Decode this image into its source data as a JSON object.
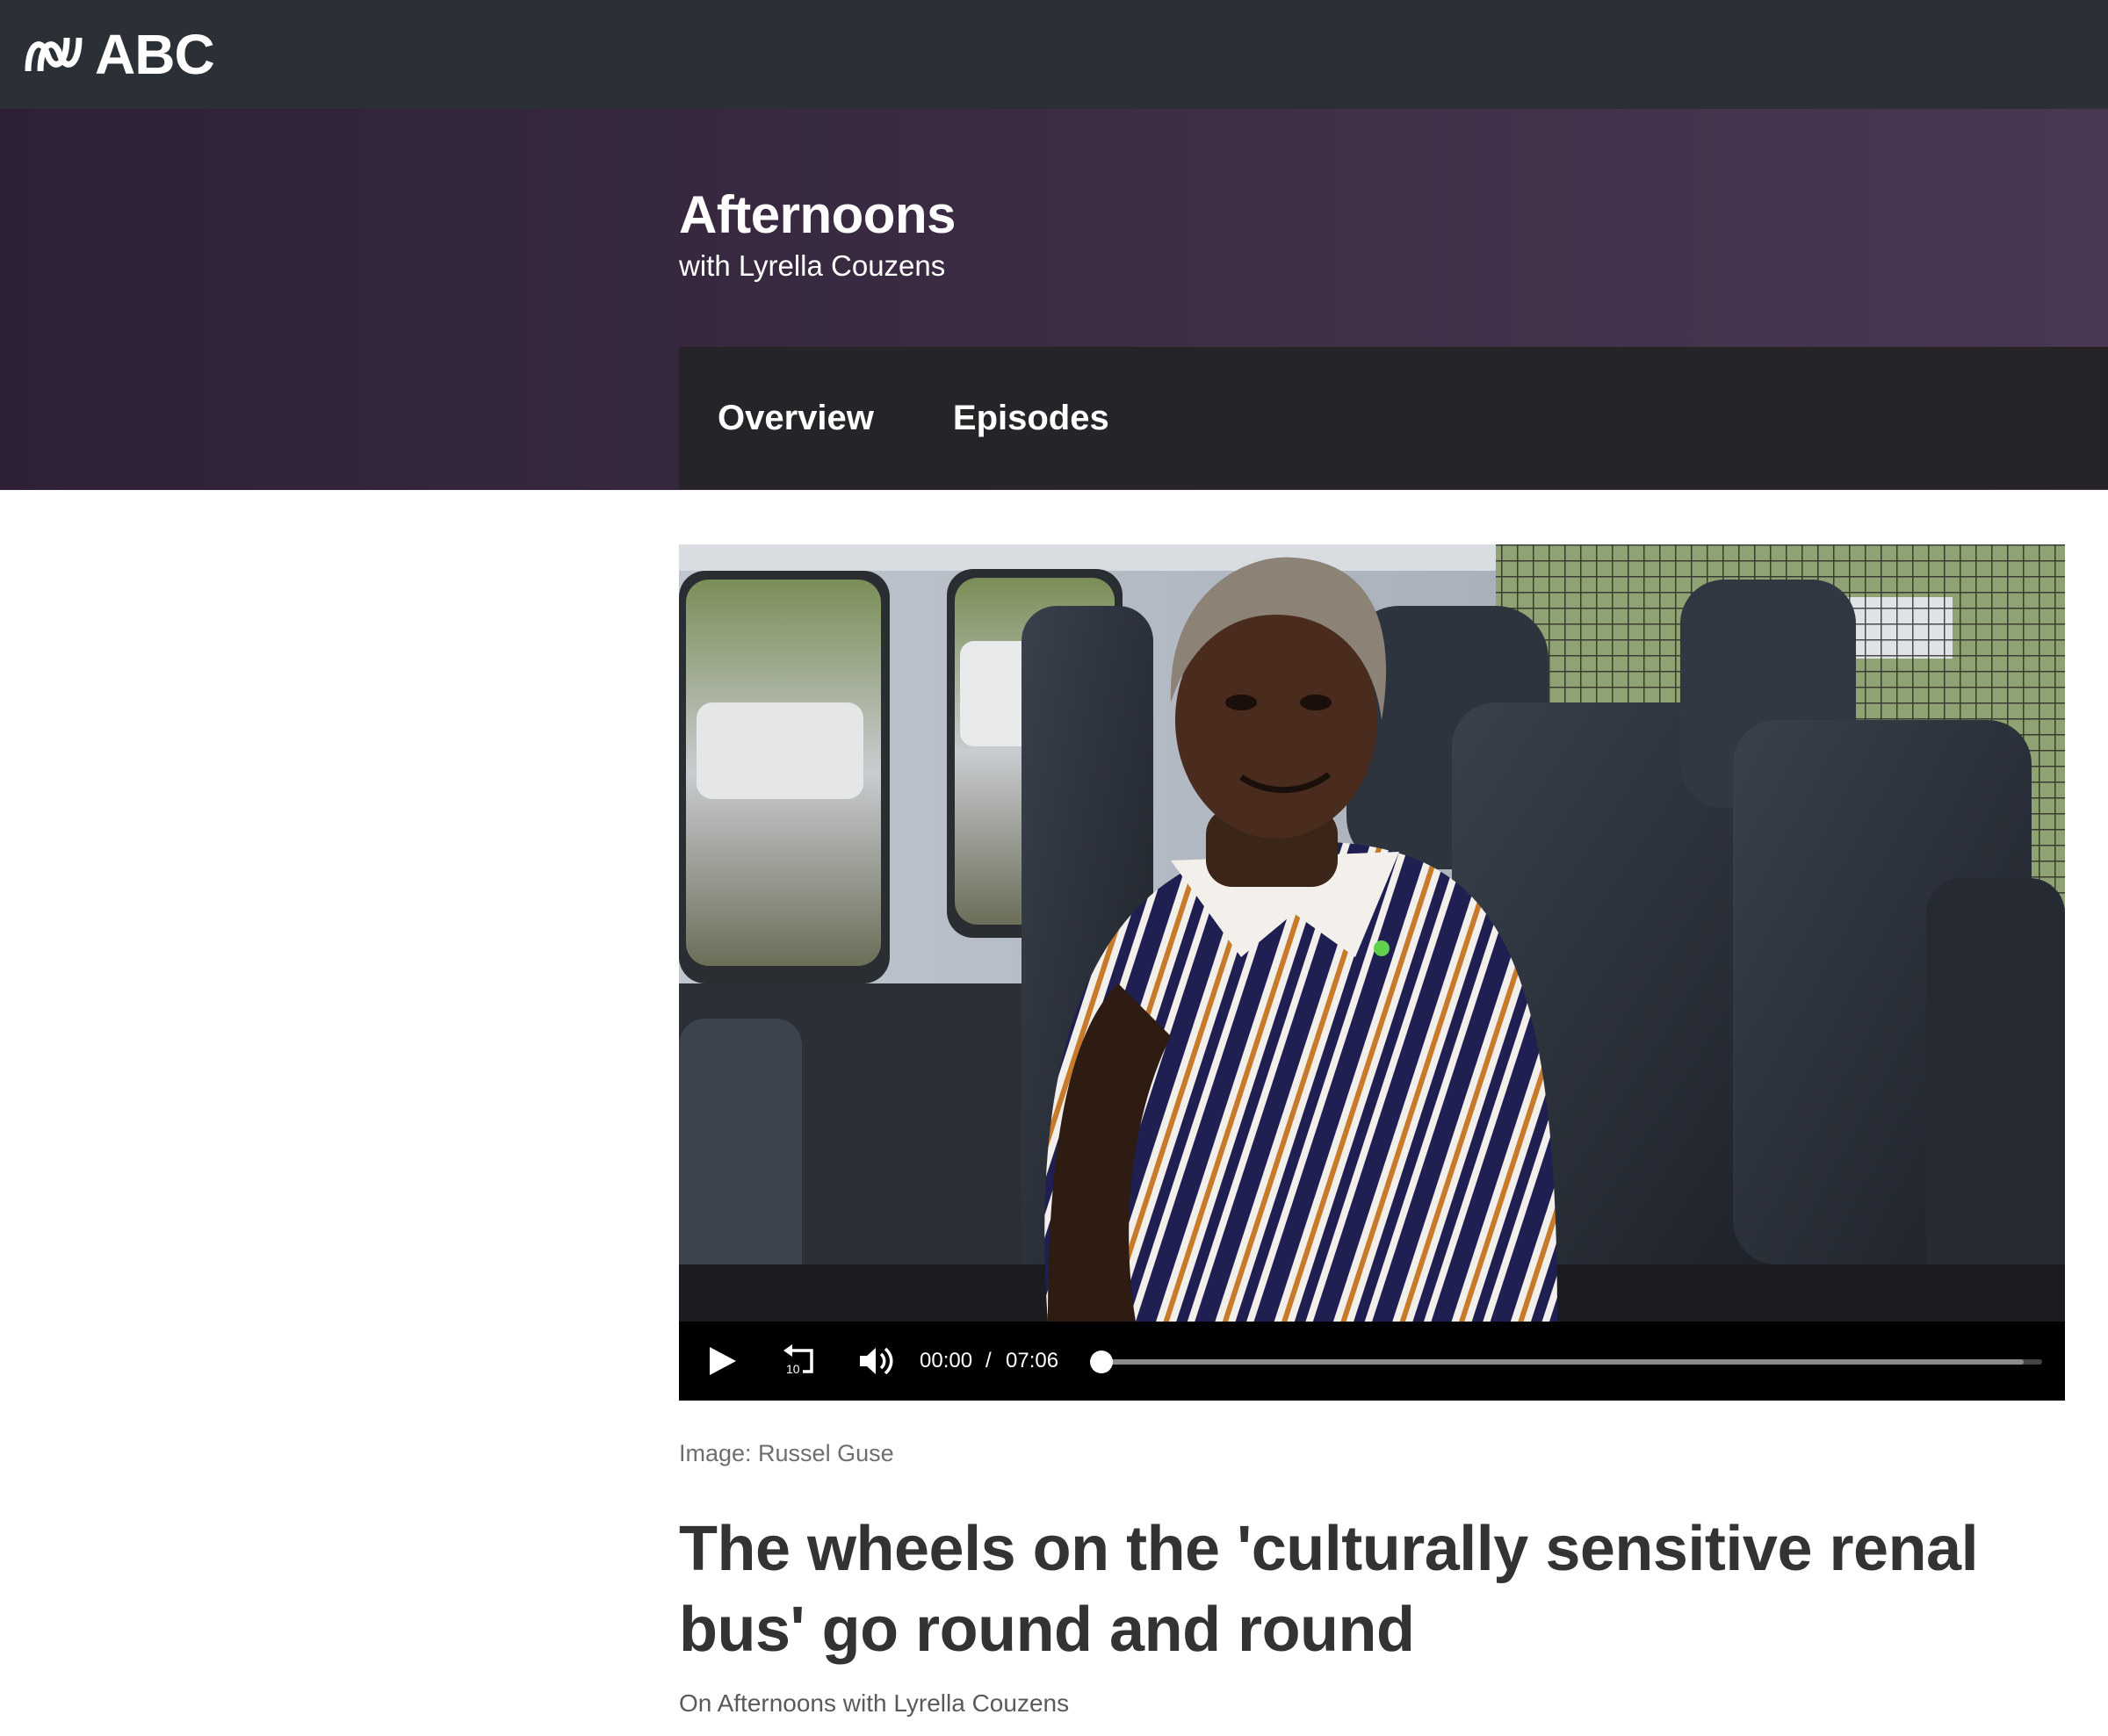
{
  "brand": {
    "name": "ABC",
    "icon": "abc-lissajous-logo-icon"
  },
  "program": {
    "title": "Afternoons",
    "subtitle": "with Lyrella Couzens"
  },
  "tabs": [
    {
      "label": "Overview"
    },
    {
      "label": "Episodes"
    }
  ],
  "player": {
    "current_time": "00:00",
    "separator": "/",
    "duration": "07:06",
    "progress_fraction": 0.0,
    "icons": {
      "play": "play-icon",
      "rewind": "rewind-10-icon",
      "rewind_label": "10",
      "volume": "volume-icon"
    }
  },
  "article": {
    "image_credit": "Image: Russel Guse",
    "headline": "The wheels on the 'culturally sensitive renal bus' go round and round",
    "byline": "On Afternoons with Lyrella Couzens"
  },
  "colors": {
    "topbar": "#2b3036",
    "header_purple": "#3a2b42",
    "tabnav": "#262428",
    "headline_text": "#333333"
  }
}
